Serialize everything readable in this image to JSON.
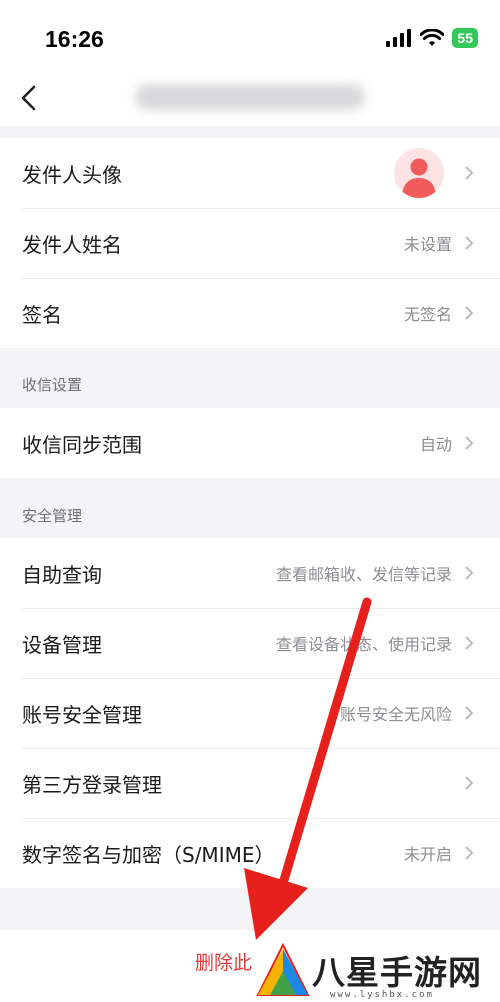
{
  "status_bar": {
    "time": "16:26",
    "battery": "55"
  },
  "groups": {
    "sender": [
      {
        "label": "发件人头像",
        "value": ""
      },
      {
        "label": "发件人姓名",
        "value": "未设置"
      },
      {
        "label": "签名",
        "value": "无签名"
      }
    ],
    "receive": [
      {
        "label": "收信同步范围",
        "value": "自动"
      }
    ],
    "security": [
      {
        "label": "自助查询",
        "value": "查看邮箱收、发信等记录"
      },
      {
        "label": "设备管理",
        "value": "查看设备状态、使用记录"
      },
      {
        "label": "账号安全管理",
        "value": "账号安全无风险"
      },
      {
        "label": "第三方登录管理",
        "value": ""
      },
      {
        "label": "数字签名与加密（S/MIME）",
        "value": "未开启"
      }
    ]
  },
  "sections": {
    "receive_header": "收信设置",
    "security_header": "安全管理"
  },
  "bottom": {
    "delete_label": "删除此"
  },
  "watermark": {
    "text": "八星手游网",
    "url": "www.lyshbx.com"
  },
  "colors": {
    "accent_red": "#e03a3a",
    "arrow_red": "#e8201c",
    "battery_green": "#34c759"
  }
}
